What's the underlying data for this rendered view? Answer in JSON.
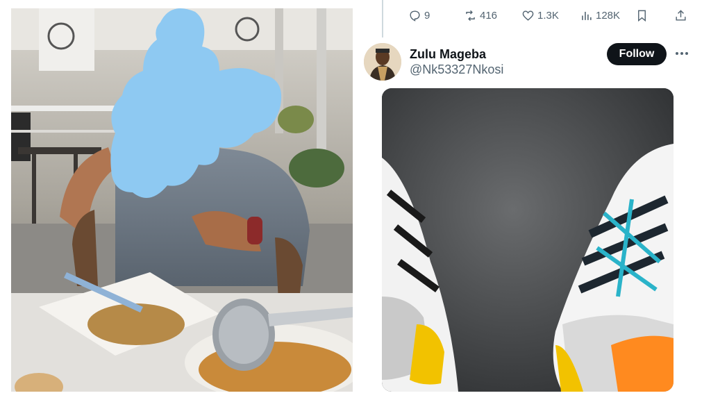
{
  "tweet": {
    "actions": {
      "replies": "9",
      "reposts": "416",
      "likes": "1.3K",
      "views": "128K"
    },
    "author": {
      "name": "Zulu Mageba",
      "handle": "@Nk53327Nkosi",
      "follow_label": "Follow"
    }
  },
  "icons": {
    "reply": "reply-icon",
    "repost": "repost-icon",
    "like": "heart-icon",
    "views": "views-icon",
    "bookmark": "bookmark-icon",
    "share": "share-icon",
    "more": "more-icon"
  },
  "colors": {
    "text_primary": "#0f1419",
    "text_secondary": "#536471",
    "follow_bg": "#0f1419",
    "blur_blob": "#8ec9f2"
  }
}
